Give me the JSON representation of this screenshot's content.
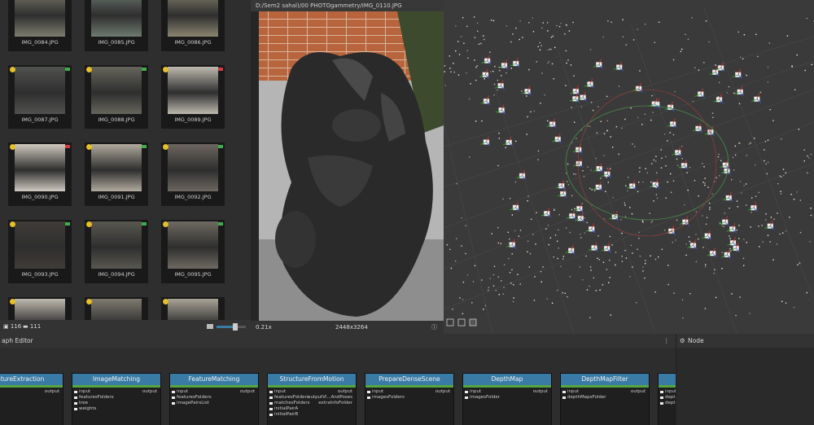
{
  "gallery": {
    "thumbnails": [
      {
        "name": "IMG_0084.JPG",
        "flag": ""
      },
      {
        "name": "IMG_0085.JPG",
        "flag": ""
      },
      {
        "name": "IMG_0086.JPG",
        "flag": ""
      },
      {
        "name": "IMG_0087.JPG",
        "flag": "#3fae4a"
      },
      {
        "name": "IMG_0088.JPG",
        "flag": "#3fae4a"
      },
      {
        "name": "IMG_0089.JPG",
        "flag": "#d23c3c"
      },
      {
        "name": "IMG_0090.JPG",
        "flag": "#d23c3c"
      },
      {
        "name": "IMG_0091.JPG",
        "flag": "#3fae4a"
      },
      {
        "name": "IMG_0092.JPG",
        "flag": "#3fae4a"
      },
      {
        "name": "IMG_0093.JPG",
        "flag": "#3fae4a"
      },
      {
        "name": "IMG_0094.JPG",
        "flag": "#3fae4a"
      },
      {
        "name": "IMG_0095.JPG",
        "flag": "#3fae4a"
      },
      {
        "name": "",
        "flag": ""
      },
      {
        "name": "",
        "flag": ""
      },
      {
        "name": "",
        "flag": ""
      }
    ],
    "footer": {
      "image_count": "116",
      "camera_count": "111"
    }
  },
  "viewer": {
    "path": "D:/Sem2 sahal)/00 PHOTOgammetry/IMG_0110.JPG",
    "zoom": "0.21x",
    "resolution": "2448x3264"
  },
  "graph": {
    "title": "aph Editor",
    "menu": "⋮",
    "nodes": [
      {
        "title": "eatureExtraction",
        "inputs": [],
        "outputs": [
          "output"
        ]
      },
      {
        "title": "ImageMatching",
        "inputs": [
          "input",
          "featuresFolders",
          "tree",
          "weights"
        ],
        "outputs": [
          "output"
        ]
      },
      {
        "title": "FeatureMatching",
        "inputs": [
          "input",
          "featuresFolders",
          "imagePairsList"
        ],
        "outputs": [
          "output"
        ]
      },
      {
        "title": "StructureFromMotion",
        "inputs": [
          "input",
          "featuresFolders",
          "matchesFolders",
          "initialPairA",
          "initialPairB"
        ],
        "outputs": [
          "output",
          "outputVi...AndPoses",
          "extraInfoFolder"
        ]
      },
      {
        "title": "PrepareDenseScene",
        "inputs": [
          "input",
          "imagesFolders"
        ],
        "outputs": [
          "output"
        ]
      },
      {
        "title": "DepthMap",
        "inputs": [
          "input",
          "imagesFolder"
        ],
        "outputs": [
          "output"
        ]
      },
      {
        "title": "DepthMapFilter",
        "inputs": [
          "input",
          "depthMapsFolder"
        ],
        "outputs": [
          "output"
        ]
      },
      {
        "title": "",
        "inputs": [
          "input",
          "depth",
          "depth"
        ],
        "outputs": []
      }
    ]
  },
  "node_panel": {
    "title": "Node"
  },
  "colors": {
    "node_header": "#3a7ba6",
    "node_status": "#56a63f",
    "star": "#e6c02a"
  }
}
